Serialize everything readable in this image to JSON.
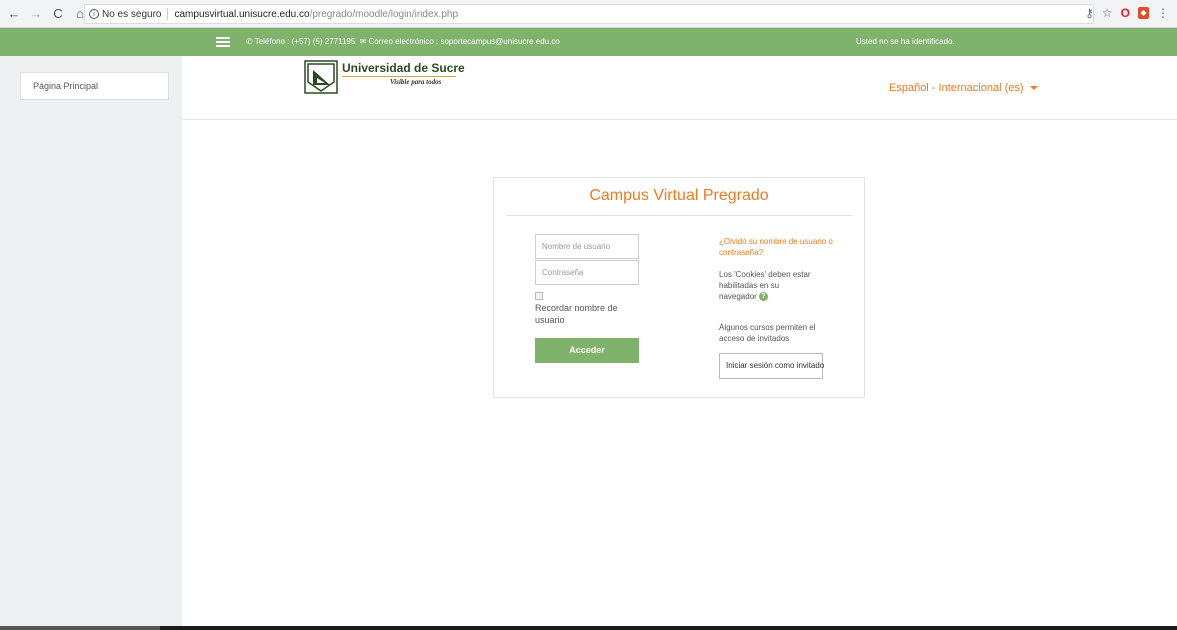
{
  "browser": {
    "nav_back": "←",
    "nav_forward": "→",
    "nav_reload": "C",
    "nav_home": "⌂",
    "secure_label": "No es seguro",
    "url_host": "campusvirtual.unisucre.edu.co",
    "url_path": "/pregrado/moodle/login/index.php",
    "icons": [
      "key-icon",
      "star-icon",
      "opera-icon",
      "extension-icon",
      "menu-icon"
    ]
  },
  "topbar": {
    "phone": "Teléfono : (+57) (5) 2771195",
    "email": "Correo electrónico : soportecampus@unisucre.edu.co",
    "status": "Usted no se ha identificado.",
    "color": "#7fb26b"
  },
  "sidebar": {
    "items": [
      {
        "label": "Página Principal"
      }
    ]
  },
  "header": {
    "logo_title": "Universidad de Sucre",
    "logo_slogan": "Visible para todos",
    "language": "Español - Internacional (es)"
  },
  "login": {
    "title": "Campus Virtual Pregrado",
    "username_placeholder": "Nombre de usuario",
    "password_placeholder": "Contraseña",
    "remember_label": "Recordar nombre de usuario",
    "submit_label": "Acceder",
    "forgot_link": "¿Olvidó su nombre de usuario o contraseña?",
    "cookies_text": "Los 'Cookies' deben estar habilitadas en su navegador",
    "guest_text": "Algunos cursos permiten el acceso de invitados",
    "guest_button": "Iniciar sesión como invitado"
  },
  "colors": {
    "accent": "#ef7a1f",
    "green": "#7fb26b"
  }
}
